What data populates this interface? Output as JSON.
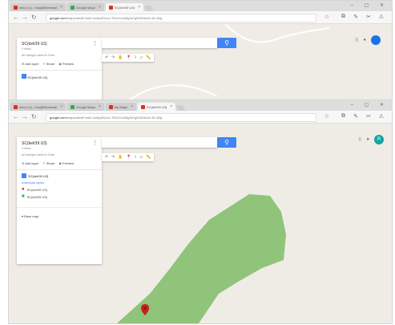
{
  "shot1": {
    "tabs": [
      {
        "label": "Inbox (1) - hxxj@Workmail"
      },
      {
        "label": "Google Maps"
      },
      {
        "label": "SC(kelr39 U3)",
        "active": true
      }
    ],
    "window_controls": "– ▢ ✕",
    "url_host": "google.com",
    "url_path": "/maps/d/edit?mid=1w6yuRLmc-TRu4V-sA5g0e7gDWDh&ll=16.4f2g",
    "search_button_icon": "search-icon",
    "drawing_tools": [
      "↶",
      "↷",
      "✋",
      "📍",
      "⌇",
      "▱",
      "📏"
    ],
    "panel": {
      "title": "SC(kelr39 U3)",
      "subtitle": "0 views",
      "note": "All changes saved in Drive",
      "actions": [
        {
          "icon": "⊕",
          "label": "Add layer"
        },
        {
          "icon": "⇪",
          "label": "Share"
        },
        {
          "icon": "◉",
          "label": "Preview"
        }
      ],
      "layer_peek": "SC(kelr39 U3)"
    },
    "corner_icons": [
      "⠿",
      "●"
    ]
  },
  "shot2": {
    "tabs": [
      {
        "label": "Inbox (1) - hxxj@Workmail"
      },
      {
        "label": "Google Maps"
      },
      {
        "label": "My Maps"
      },
      {
        "label": "SC(kelr39 U3)",
        "active": true
      }
    ],
    "window_controls": "– ▢ ✕",
    "url_host": "google.com",
    "url_path": "/maps/d/edit?mid=1w6yuRLmc-TRu4V-sA5g0e7gDWDh&ll=16.4f2g",
    "search_button_icon": "search-icon",
    "drawing_tools": [
      "↶",
      "↷",
      "✋",
      "📍",
      "⌇",
      "▱",
      "📏"
    ],
    "panel": {
      "title": "SC(kelr39 U3)",
      "subtitle": "0 views",
      "note": "All changes saved in Drive",
      "actions": [
        {
          "icon": "⊕",
          "label": "Add layer"
        },
        {
          "icon": "⇪",
          "label": "Share"
        },
        {
          "icon": "◉",
          "label": "Preview"
        }
      ],
      "layer": {
        "title": "SC(kelr39 U3)",
        "style_link": "Individual styles",
        "items": [
          {
            "label": "SC(kelr39 U3)",
            "pin_color": "#c5221f"
          },
          {
            "label": "SC(kelr39 U3)",
            "pin_color": "#34a853"
          }
        ]
      },
      "basemap": "Base map"
    },
    "corner_icons": [
      "⠿",
      "●"
    ],
    "avatar_letter": "R",
    "map": {
      "polygon_color": "#8fc47a",
      "marker_color": "#c5221f",
      "land_color": "#efece5"
    }
  }
}
